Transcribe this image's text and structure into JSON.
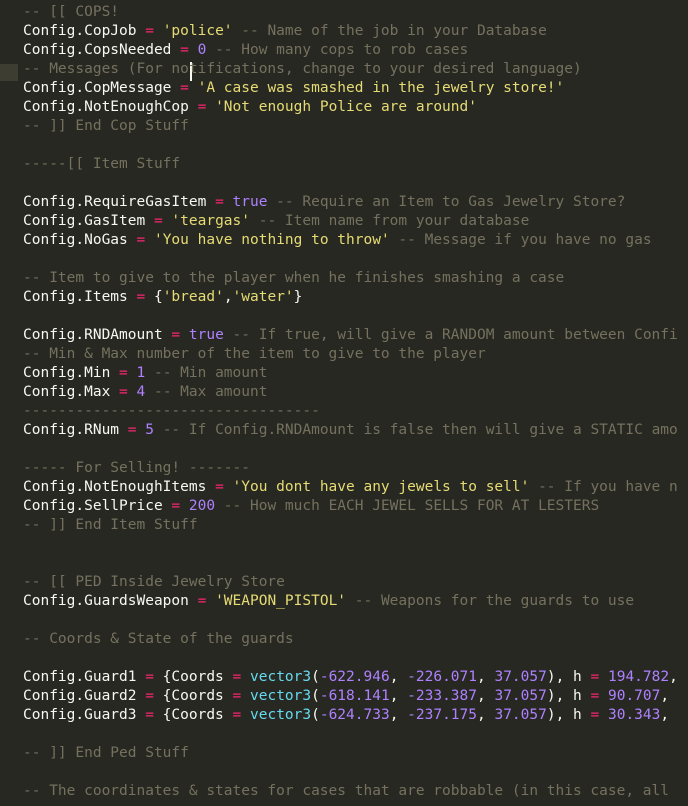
{
  "editor": {
    "colors": {
      "background": "#272822",
      "identifier": "#f8f8f2",
      "operator": "#f92672",
      "string": "#e6db74",
      "number": "#ae81ff",
      "comment": "#75715e",
      "function": "#66d9ef"
    },
    "lines": [
      [
        {
          "t": "com",
          "v": "-- [[ COPS!"
        }
      ],
      [
        {
          "t": "id",
          "v": "Config.CopJob "
        },
        {
          "t": "op",
          "v": "="
        },
        {
          "t": "pun",
          "v": " "
        },
        {
          "t": "str",
          "v": "'police'"
        },
        {
          "t": "com",
          "v": " -- Name of the job in your Database"
        }
      ],
      [
        {
          "t": "id",
          "v": "Config.CopsNeeded "
        },
        {
          "t": "op",
          "v": "="
        },
        {
          "t": "pun",
          "v": " "
        },
        {
          "t": "num",
          "v": "0"
        },
        {
          "t": "com",
          "v": " -- How many cops to rob cases"
        }
      ],
      [
        {
          "t": "com",
          "v": "-- Messages (For notifications, change to your desired language)"
        }
      ],
      [
        {
          "t": "id",
          "v": "Config.CopMessage "
        },
        {
          "t": "op",
          "v": "="
        },
        {
          "t": "pun",
          "v": " "
        },
        {
          "t": "str",
          "v": "'A case was smashed in the jewelry store!'"
        }
      ],
      [
        {
          "t": "id",
          "v": "Config.NotEnoughCop "
        },
        {
          "t": "op",
          "v": "="
        },
        {
          "t": "pun",
          "v": " "
        },
        {
          "t": "str",
          "v": "'Not enough Police are around'"
        }
      ],
      [
        {
          "t": "com",
          "v": "-- ]] End Cop Stuff"
        }
      ],
      [],
      [
        {
          "t": "com",
          "v": "-----[[ Item Stuff"
        }
      ],
      [],
      [
        {
          "t": "id",
          "v": "Config.RequireGasItem "
        },
        {
          "t": "op",
          "v": "="
        },
        {
          "t": "pun",
          "v": " "
        },
        {
          "t": "bool",
          "v": "true"
        },
        {
          "t": "com",
          "v": " -- Require an Item to Gas Jewelry Store?"
        }
      ],
      [
        {
          "t": "id",
          "v": "Config.GasItem "
        },
        {
          "t": "op",
          "v": "="
        },
        {
          "t": "pun",
          "v": " "
        },
        {
          "t": "str",
          "v": "'teargas'"
        },
        {
          "t": "com",
          "v": " -- Item name from your database"
        }
      ],
      [
        {
          "t": "id",
          "v": "Config.NoGas "
        },
        {
          "t": "op",
          "v": "="
        },
        {
          "t": "pun",
          "v": " "
        },
        {
          "t": "str",
          "v": "'You have nothing to throw'"
        },
        {
          "t": "com",
          "v": " -- Message if you have no gas"
        }
      ],
      [],
      [
        {
          "t": "com",
          "v": "-- Item to give to the player when he finishes smashing a case"
        }
      ],
      [
        {
          "t": "id",
          "v": "Config.Items "
        },
        {
          "t": "op",
          "v": "="
        },
        {
          "t": "pun",
          "v": " {"
        },
        {
          "t": "str",
          "v": "'bread'"
        },
        {
          "t": "pun",
          "v": ","
        },
        {
          "t": "str",
          "v": "'water'"
        },
        {
          "t": "pun",
          "v": "}"
        }
      ],
      [],
      [
        {
          "t": "id",
          "v": "Config.RNDAmount "
        },
        {
          "t": "op",
          "v": "="
        },
        {
          "t": "pun",
          "v": " "
        },
        {
          "t": "bool",
          "v": "true"
        },
        {
          "t": "com",
          "v": " -- If true, will give a RANDOM amount between Confi"
        }
      ],
      [
        {
          "t": "com",
          "v": "-- Min & Max number of the item to give to the player"
        }
      ],
      [
        {
          "t": "id",
          "v": "Config.Min "
        },
        {
          "t": "op",
          "v": "="
        },
        {
          "t": "pun",
          "v": " "
        },
        {
          "t": "num",
          "v": "1"
        },
        {
          "t": "com",
          "v": " -- Min amount"
        }
      ],
      [
        {
          "t": "id",
          "v": "Config.Max "
        },
        {
          "t": "op",
          "v": "="
        },
        {
          "t": "pun",
          "v": " "
        },
        {
          "t": "num",
          "v": "4"
        },
        {
          "t": "com",
          "v": " -- Max amount"
        }
      ],
      [
        {
          "t": "com",
          "v": "----------------------------------"
        }
      ],
      [
        {
          "t": "id",
          "v": "Config.RNum "
        },
        {
          "t": "op",
          "v": "="
        },
        {
          "t": "pun",
          "v": " "
        },
        {
          "t": "num",
          "v": "5"
        },
        {
          "t": "com",
          "v": " -- If Config.RNDAmount is false then will give a STATIC amo"
        }
      ],
      [],
      [
        {
          "t": "com",
          "v": "----- For Selling! -------"
        }
      ],
      [
        {
          "t": "id",
          "v": "Config.NotEnoughItems "
        },
        {
          "t": "op",
          "v": "="
        },
        {
          "t": "pun",
          "v": " "
        },
        {
          "t": "str",
          "v": "'You dont have any jewels to sell'"
        },
        {
          "t": "com",
          "v": " -- If you have n"
        }
      ],
      [
        {
          "t": "id",
          "v": "Config.SellPrice "
        },
        {
          "t": "op",
          "v": "="
        },
        {
          "t": "pun",
          "v": " "
        },
        {
          "t": "num",
          "v": "200"
        },
        {
          "t": "com",
          "v": " -- How much EACH JEWEL SELLS FOR AT LESTERS"
        }
      ],
      [
        {
          "t": "com",
          "v": "-- ]] End Item Stuff"
        }
      ],
      [],
      [],
      [
        {
          "t": "com",
          "v": "-- [[ PED Inside Jewelry Store"
        }
      ],
      [
        {
          "t": "id",
          "v": "Config.GuardsWeapon "
        },
        {
          "t": "op",
          "v": "="
        },
        {
          "t": "pun",
          "v": " "
        },
        {
          "t": "str",
          "v": "'WEAPON_PISTOL'"
        },
        {
          "t": "com",
          "v": " -- Weapons for the guards to use"
        }
      ],
      [],
      [
        {
          "t": "com",
          "v": "-- Coords & State of the guards"
        }
      ],
      [],
      [
        {
          "t": "id",
          "v": "Config.Guard1 "
        },
        {
          "t": "op",
          "v": "="
        },
        {
          "t": "pun",
          "v": " {Coords "
        },
        {
          "t": "op",
          "v": "="
        },
        {
          "t": "pun",
          "v": " "
        },
        {
          "t": "fn",
          "v": "vector3"
        },
        {
          "t": "pun",
          "v": "("
        },
        {
          "t": "num",
          "v": "-622.946"
        },
        {
          "t": "pun",
          "v": ", "
        },
        {
          "t": "num",
          "v": "-226.071"
        },
        {
          "t": "pun",
          "v": ", "
        },
        {
          "t": "num",
          "v": "37.057"
        },
        {
          "t": "pun",
          "v": "), h "
        },
        {
          "t": "op",
          "v": "="
        },
        {
          "t": "pun",
          "v": " "
        },
        {
          "t": "num",
          "v": "194.782"
        },
        {
          "t": "pun",
          "v": ","
        }
      ],
      [
        {
          "t": "id",
          "v": "Config.Guard2 "
        },
        {
          "t": "op",
          "v": "="
        },
        {
          "t": "pun",
          "v": " {Coords "
        },
        {
          "t": "op",
          "v": "="
        },
        {
          "t": "pun",
          "v": " "
        },
        {
          "t": "fn",
          "v": "vector3"
        },
        {
          "t": "pun",
          "v": "("
        },
        {
          "t": "num",
          "v": "-618.141"
        },
        {
          "t": "pun",
          "v": ", "
        },
        {
          "t": "num",
          "v": "-233.387"
        },
        {
          "t": "pun",
          "v": ", "
        },
        {
          "t": "num",
          "v": "37.057"
        },
        {
          "t": "pun",
          "v": "), h "
        },
        {
          "t": "op",
          "v": "="
        },
        {
          "t": "pun",
          "v": " "
        },
        {
          "t": "num",
          "v": "90.707"
        },
        {
          "t": "pun",
          "v": ","
        }
      ],
      [
        {
          "t": "id",
          "v": "Config.Guard3 "
        },
        {
          "t": "op",
          "v": "="
        },
        {
          "t": "pun",
          "v": " {Coords "
        },
        {
          "t": "op",
          "v": "="
        },
        {
          "t": "pun",
          "v": " "
        },
        {
          "t": "fn",
          "v": "vector3"
        },
        {
          "t": "pun",
          "v": "("
        },
        {
          "t": "num",
          "v": "-624.733"
        },
        {
          "t": "pun",
          "v": ", "
        },
        {
          "t": "num",
          "v": "-237.175"
        },
        {
          "t": "pun",
          "v": ", "
        },
        {
          "t": "num",
          "v": "37.057"
        },
        {
          "t": "pun",
          "v": "), h "
        },
        {
          "t": "op",
          "v": "="
        },
        {
          "t": "pun",
          "v": " "
        },
        {
          "t": "num",
          "v": "30.343"
        },
        {
          "t": "pun",
          "v": ","
        }
      ],
      [],
      [
        {
          "t": "com",
          "v": "-- ]] End Ped Stuff"
        }
      ],
      [],
      [
        {
          "t": "com",
          "v": "-- The coordinates & states for cases that are robbable (in this case, all"
        }
      ]
    ]
  }
}
